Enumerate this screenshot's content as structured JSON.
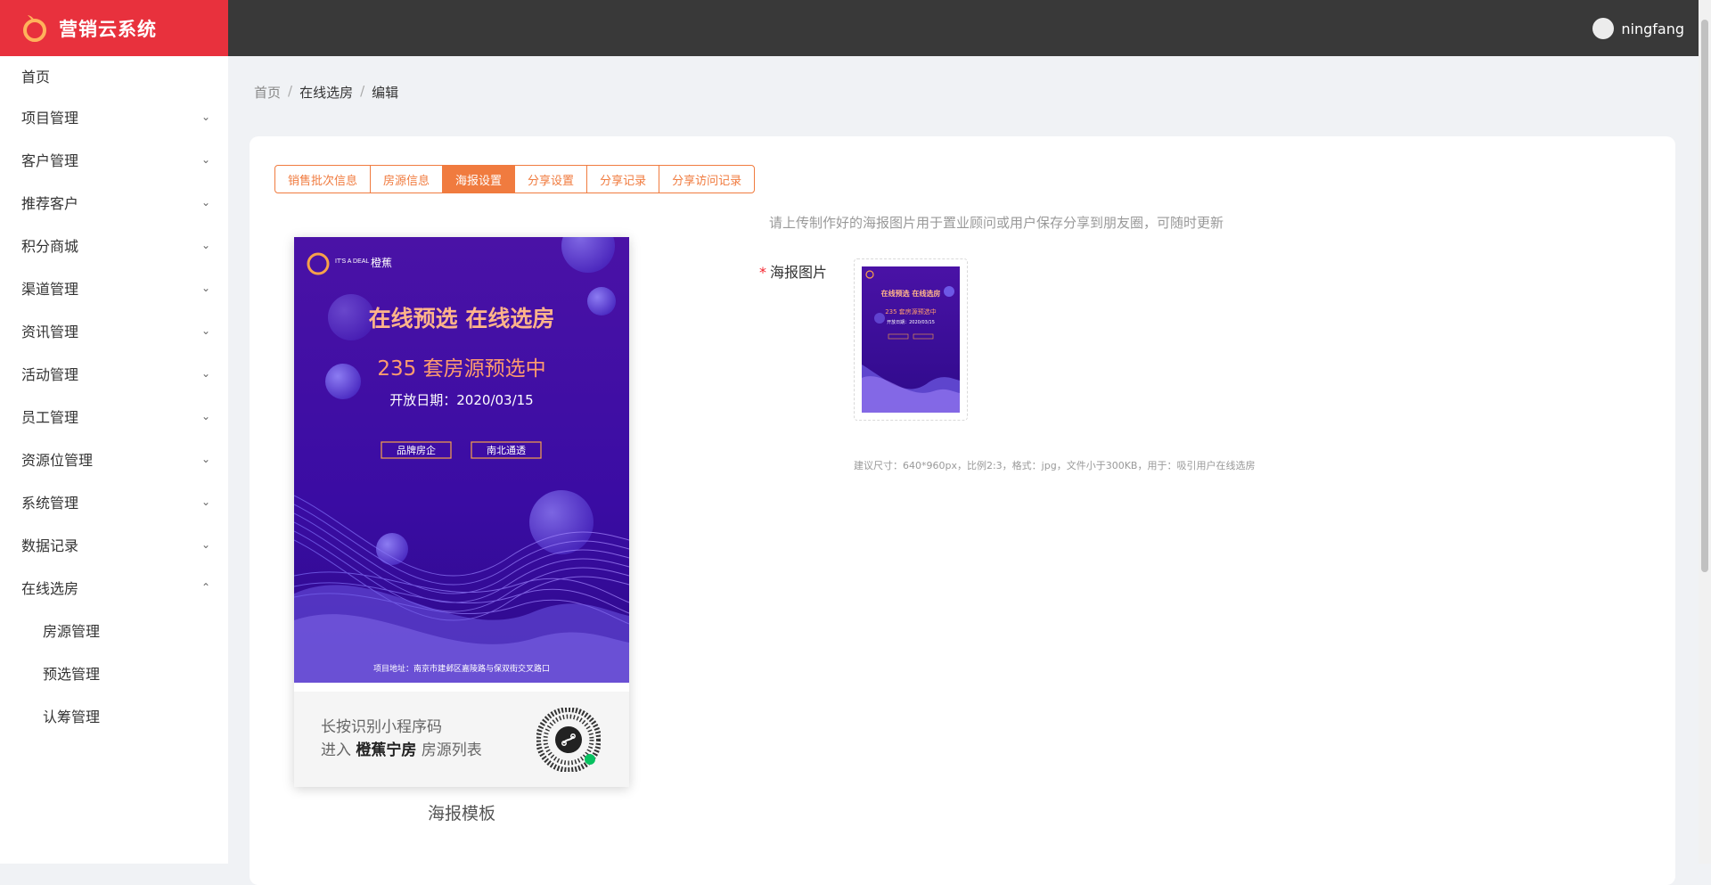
{
  "app": {
    "title": "营销云系统"
  },
  "user": {
    "name": "ningfang"
  },
  "sidebar": {
    "items": [
      {
        "label": "首页"
      },
      {
        "label": "项目管理"
      },
      {
        "label": "客户管理"
      },
      {
        "label": "推荐客户"
      },
      {
        "label": "积分商城"
      },
      {
        "label": "渠道管理"
      },
      {
        "label": "资讯管理"
      },
      {
        "label": "活动管理"
      },
      {
        "label": "员工管理"
      },
      {
        "label": "资源位管理"
      },
      {
        "label": "系统管理"
      },
      {
        "label": "数据记录"
      },
      {
        "label": "在线选房"
      }
    ],
    "subitems": [
      {
        "label": "房源管理"
      },
      {
        "label": "预选管理"
      },
      {
        "label": "认筹管理"
      }
    ]
  },
  "breadcrumb": {
    "home": "首页",
    "section": "在线选房",
    "current": "编辑",
    "sep": "/"
  },
  "tabs": [
    {
      "label": "销售批次信息"
    },
    {
      "label": "房源信息"
    },
    {
      "label": "海报设置"
    },
    {
      "label": "分享设置"
    },
    {
      "label": "分享记录"
    },
    {
      "label": "分享访问记录"
    }
  ],
  "poster": {
    "brand_en": "IT'S A DEAL",
    "brand_cn": "橙蕉",
    "headline": "在线预选  在线选房",
    "subhead": "235 套房源预选中",
    "open_date": "开放日期：2020/03/15",
    "tag1": "品牌房企",
    "tag2": "南北通透",
    "address": "项目地址：南京市建邺区嘉陵路与保双街交叉路口",
    "footer_line1": "长按识别小程序码",
    "footer_line2_prefix": "进入",
    "footer_line2_bold": "橙蕉宁房",
    "footer_line2_suffix": "房源列表",
    "caption": "海报模板"
  },
  "form": {
    "hint": "请上传制作好的海报图片用于置业顾问或用户保存分享到朋友圈，可随时更新",
    "label": "海报图片",
    "required_mark": "*",
    "tip": "建议尺寸：640*960px，比例2:3，格式：jpg，文件小于300KB，用于：吸引用户在线选房"
  },
  "colors": {
    "brand_red": "#e8313d",
    "accent_orange": "#f07b3f",
    "poster_purple": "#3a0ca3"
  }
}
